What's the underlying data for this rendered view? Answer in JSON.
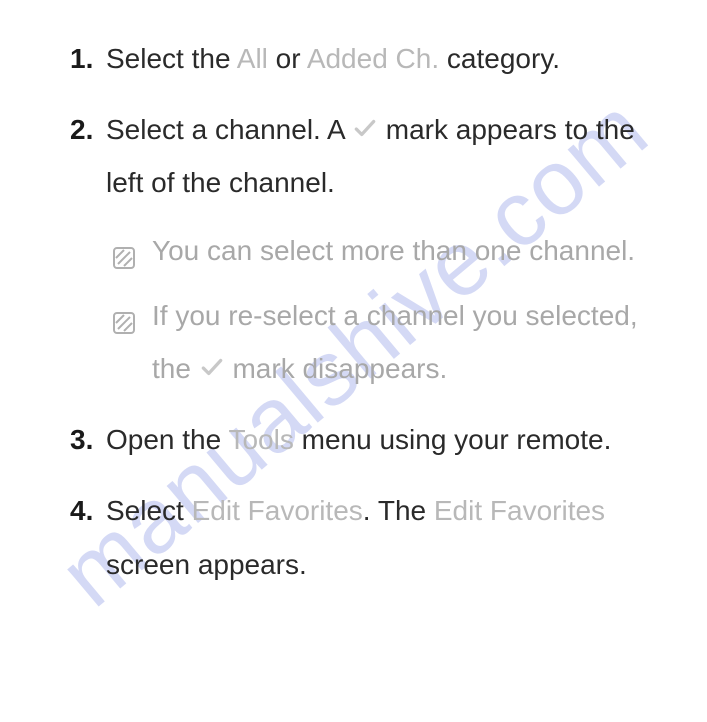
{
  "watermark": "manualshive.com",
  "steps": [
    {
      "parts": [
        {
          "t": "Select the ",
          "cls": "bold"
        },
        {
          "t": "All",
          "cls": "light"
        },
        {
          "t": " or ",
          "cls": "bold"
        },
        {
          "t": "Added Ch.",
          "cls": "light"
        },
        {
          "t": " category.",
          "cls": "bold"
        }
      ],
      "notes": []
    },
    {
      "parts": [
        {
          "t": "Select a channel. A ",
          "cls": "bold"
        },
        {
          "icon": "check"
        },
        {
          "t": " mark appears to the left of the channel.",
          "cls": "bold"
        }
      ],
      "notes": [
        {
          "parts": [
            {
              "t": "You can select more than one channel."
            }
          ]
        },
        {
          "parts": [
            {
              "t": "If you re-select a channel you selected, the "
            },
            {
              "icon": "check"
            },
            {
              "t": " mark disappears."
            }
          ]
        }
      ]
    },
    {
      "parts": [
        {
          "t": "Open the ",
          "cls": "bold"
        },
        {
          "t": "Tools",
          "cls": "light"
        },
        {
          "t": " menu using your remote.",
          "cls": "bold"
        }
      ],
      "notes": []
    },
    {
      "parts": [
        {
          "t": "Select ",
          "cls": "bold"
        },
        {
          "t": "Edit Favorites",
          "cls": "light"
        },
        {
          "t": ". The ",
          "cls": "bold"
        },
        {
          "t": "Edit Favorites",
          "cls": "light"
        },
        {
          "t": " screen appears.",
          "cls": "bold"
        }
      ],
      "notes": []
    }
  ]
}
